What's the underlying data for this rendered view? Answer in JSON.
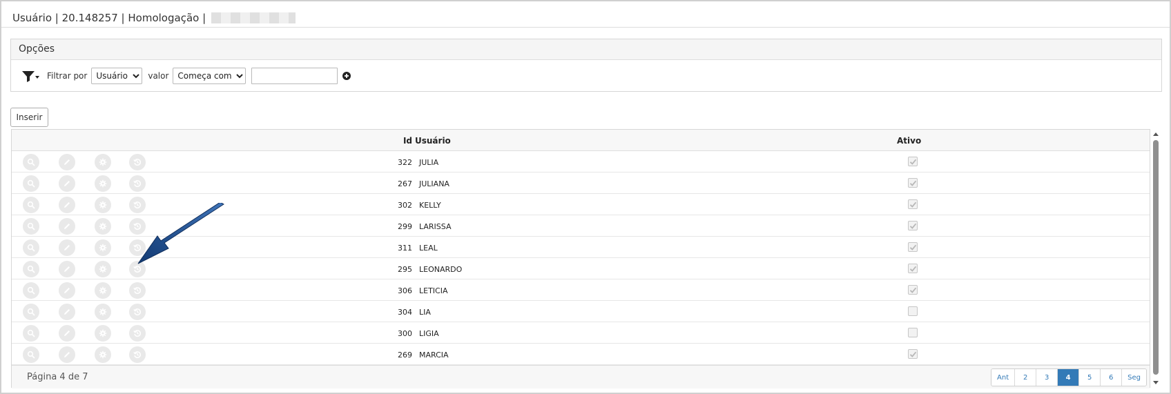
{
  "title": {
    "module": "Usuário",
    "sep1": "|",
    "version": "20.148257",
    "sep2": "|",
    "env": "Homologação",
    "sep3": "|"
  },
  "options": {
    "heading": "Opções",
    "filter_label": "Filtrar por",
    "filter_field": "Usuário",
    "value_label": "valor",
    "operator": "Começa com",
    "value": ""
  },
  "toolbar": {
    "insert_label": "Inserir"
  },
  "grid": {
    "columns": {
      "id": "Id",
      "user": "Usuário",
      "active": "Ativo"
    },
    "rows": [
      {
        "id": "322",
        "user": "JULIA",
        "active": true
      },
      {
        "id": "267",
        "user": "JULIANA",
        "active": true
      },
      {
        "id": "302",
        "user": "KELLY",
        "active": true
      },
      {
        "id": "299",
        "user": "LARISSA",
        "active": true
      },
      {
        "id": "311",
        "user": "LEAL",
        "active": true
      },
      {
        "id": "295",
        "user": "LEONARDO",
        "active": true
      },
      {
        "id": "306",
        "user": "LETICIA",
        "active": true
      },
      {
        "id": "304",
        "user": "LIA",
        "active": false
      },
      {
        "id": "300",
        "user": "LIGIA",
        "active": false
      },
      {
        "id": "269",
        "user": "MARCIA",
        "active": true
      }
    ],
    "row_actions": [
      "search-icon",
      "pencil-icon",
      "gear-icon",
      "history-icon"
    ]
  },
  "pagination": {
    "info": "Página 4 de 7",
    "prev": "Ant",
    "pages": [
      "2",
      "3",
      "4",
      "5",
      "6"
    ],
    "current": "4",
    "next": "Seg"
  },
  "colors": {
    "accent": "#337ab7",
    "annotation_arrow": "#1f4e8c"
  }
}
